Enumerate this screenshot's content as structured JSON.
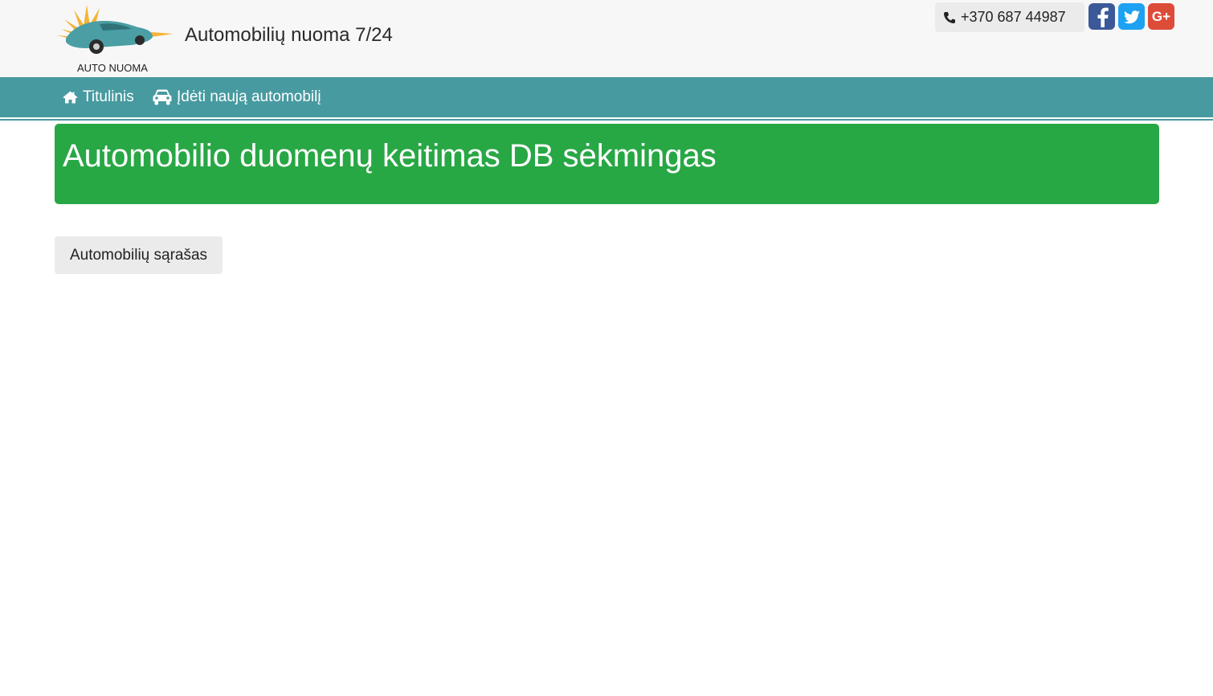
{
  "header": {
    "logo_text": "AUTO NUOMA",
    "site_title": "Automobilių nuoma 7/24",
    "phone": "+370 687 44987",
    "social": [
      {
        "name": "facebook-icon",
        "glyph": "f"
      },
      {
        "name": "twitter-icon"
      },
      {
        "name": "google-plus-icon",
        "glyph": "G+"
      }
    ]
  },
  "nav": {
    "items": [
      {
        "label": "Titulinis",
        "icon": "home-icon"
      },
      {
        "label": "Įdėti naują automobilį",
        "icon": "car-icon"
      }
    ]
  },
  "alert": {
    "message": "Automobilio duomenų keitimas DB sėkmingas",
    "color": "#28a745"
  },
  "actions": {
    "list_button": "Automobilių sąrašas"
  },
  "colors": {
    "navbar": "#479aa0",
    "header_bg": "#f7f7f7"
  }
}
